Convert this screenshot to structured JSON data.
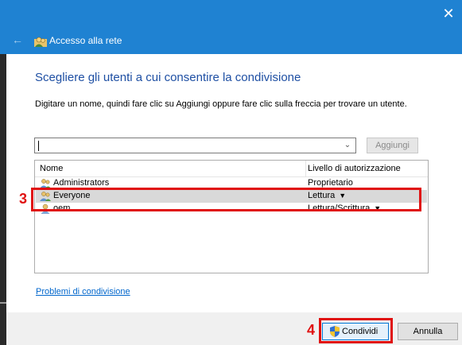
{
  "window": {
    "title": "Accesso alla rete",
    "close_glyph": "✕",
    "back_glyph": "←"
  },
  "main": {
    "heading": "Scegliere gli utenti a cui consentire la condivisione",
    "instructions": "Digitare un nome, quindi fare clic su Aggiungi oppure fare clic sulla freccia per trovare un utente.",
    "name_input": {
      "value": ""
    },
    "add_button_label": "Aggiungi",
    "table": {
      "columns": [
        "Nome",
        "Livello di autorizzazione"
      ],
      "rows": [
        {
          "name": "Administrators",
          "permission": "Proprietario",
          "has_dropdown": false,
          "icon": "group-icon"
        },
        {
          "name": "Everyone",
          "permission": "Lettura",
          "has_dropdown": true,
          "icon": "group-icon",
          "selected": true
        },
        {
          "name": "oem",
          "permission": "Lettura/Scrittura",
          "has_dropdown": true,
          "icon": "user-icon"
        }
      ]
    },
    "problems_link": "Problemi di condivisione"
  },
  "footer": {
    "share_button_label": "Condividi",
    "cancel_button_label": "Annulla"
  },
  "annotations": [
    {
      "number": "3"
    },
    {
      "number": "4"
    }
  ],
  "colors": {
    "titlebar": "#1f82d2",
    "heading": "#1e4fa3",
    "link": "#0066cc",
    "annotation": "#e01010",
    "selected_row": "#d9d9d9"
  },
  "dropdown_glyph": "▼"
}
